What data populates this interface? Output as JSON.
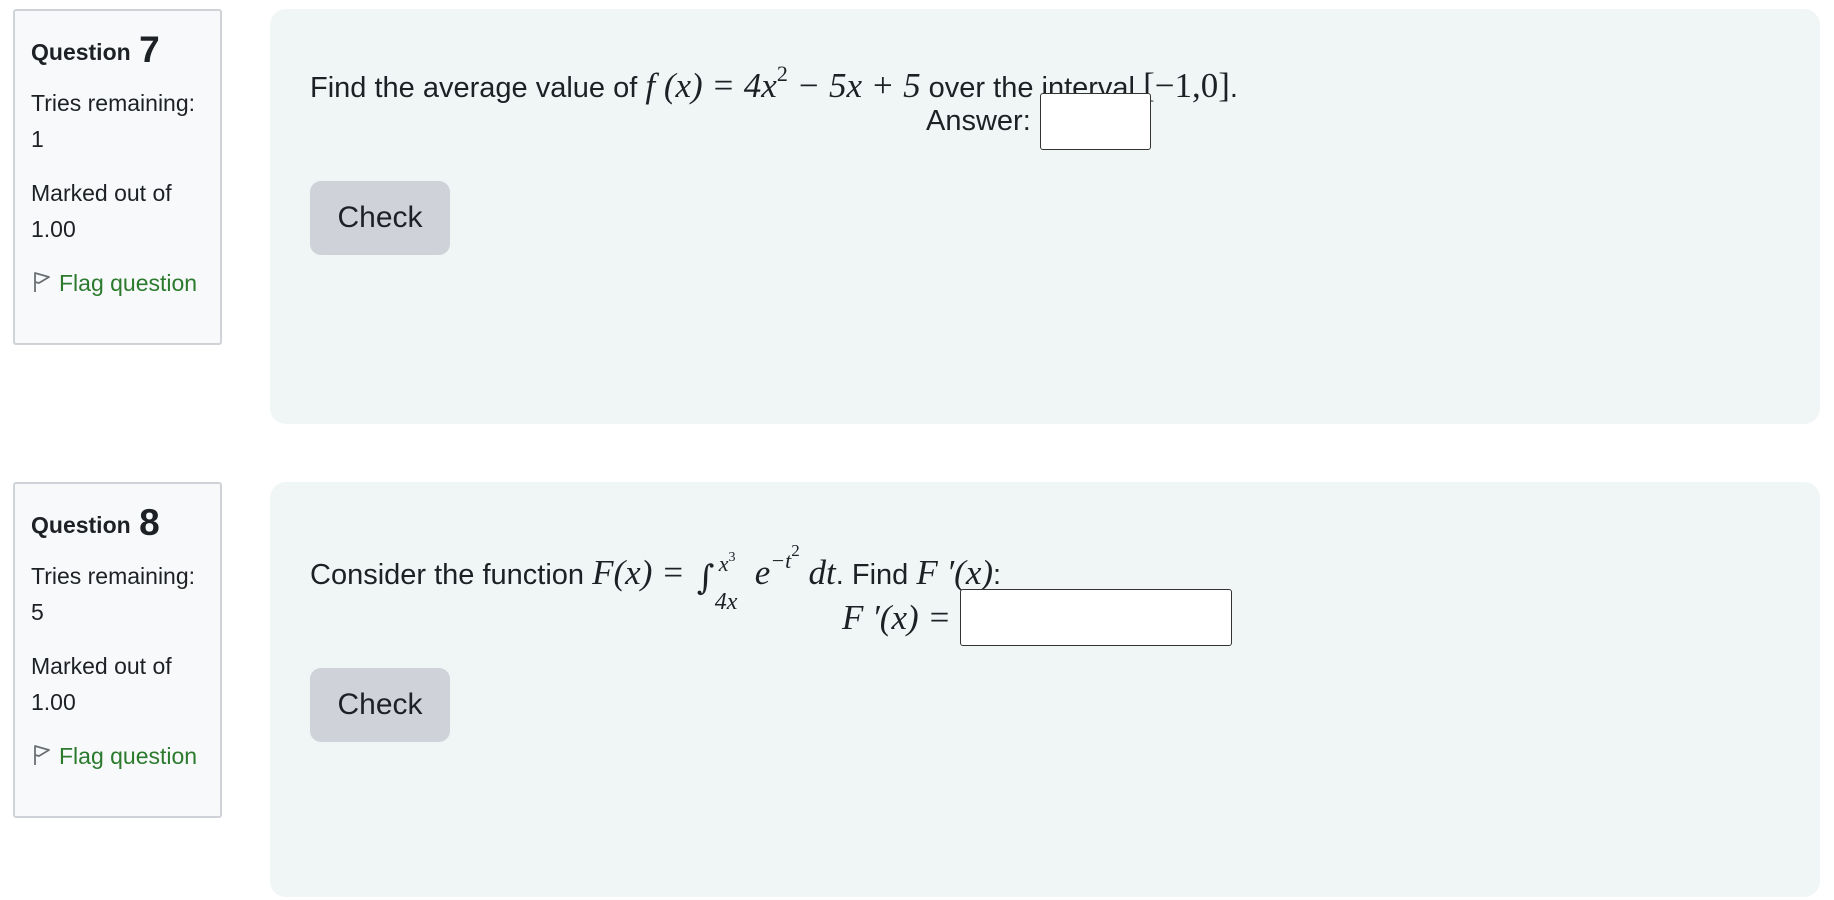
{
  "questions": [
    {
      "label": "Question",
      "number": "7",
      "tries": "Tries remaining: 1",
      "marked": "Marked out of 1.00",
      "flag": "Flag question",
      "text_prefix": "Find the average value of",
      "text_middle": "over the interval",
      "text_suffix": ".",
      "answer_label": "Answer:",
      "answer_value": "",
      "check_label": "Check"
    },
    {
      "label": "Question",
      "number": "8",
      "tries": "Tries remaining: 5",
      "marked": "Marked out of 1.00",
      "flag": "Flag question",
      "text_prefix": "Consider the function",
      "text_middle": ". Find",
      "text_suffix": ":",
      "answer_label": "F ′(x) =",
      "answer_value": "",
      "check_label": "Check"
    }
  ],
  "math": {
    "q7_fx": "f (x) = 4x",
    "q7_exp": "2",
    "q7_rest": " − 5x + 5",
    "q7_interval": "[−1,0]",
    "q8_Fx": "F(x) =",
    "q8_int_upper": "x",
    "q8_int_upper_exp": "3",
    "q8_int_lower": "4x",
    "q8_base": "e",
    "q8_exp": "−t",
    "q8_exp2": "2",
    "q8_dt": " dt",
    "q8_Fprime": "F ′(x)"
  },
  "icons": {
    "flag": "flag-outline-icon"
  },
  "colors": {
    "flag_link": "#2b7a2e",
    "content_bg": "#f0f6f6",
    "info_bg": "#f8f9fa",
    "button_bg": "#cfd3d9"
  }
}
